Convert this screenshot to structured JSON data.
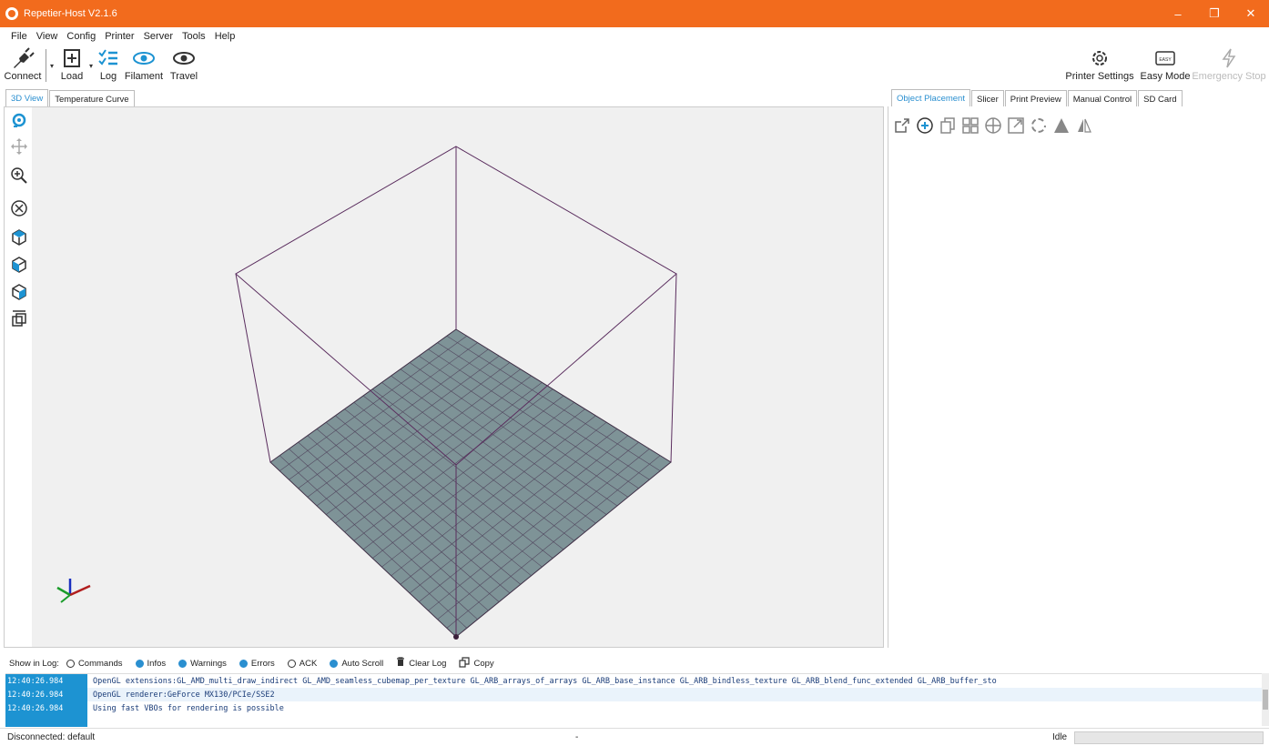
{
  "window": {
    "title": "Repetier-Host V2.1.6"
  },
  "menu": [
    "File",
    "View",
    "Config",
    "Printer",
    "Server",
    "Tools",
    "Help"
  ],
  "toolbar": {
    "connect": "Connect",
    "load": "Load",
    "log": "Log",
    "filament": "Filament",
    "travel": "Travel",
    "printer_settings": "Printer Settings",
    "easy_mode": "Easy Mode",
    "easy_badge": "EASY",
    "emergency_stop": "Emergency Stop"
  },
  "left_tabs": [
    "3D View",
    "Temperature Curve"
  ],
  "right_tabs": [
    "Object Placement",
    "Slicer",
    "Print Preview",
    "Manual Control",
    "SD Card"
  ],
  "log": {
    "show_in_log": "Show in Log:",
    "options": [
      {
        "label": "Commands",
        "on": false
      },
      {
        "label": "Infos",
        "on": true
      },
      {
        "label": "Warnings",
        "on": true
      },
      {
        "label": "Errors",
        "on": true
      },
      {
        "label": "ACK",
        "on": false
      },
      {
        "label": "Auto Scroll",
        "on": true
      }
    ],
    "clear_log": "Clear Log",
    "copy": "Copy",
    "entries": [
      {
        "time": "12:40:26.984",
        "text": "OpenGL extensions:GL_AMD_multi_draw_indirect GL_AMD_seamless_cubemap_per_texture GL_ARB_arrays_of_arrays GL_ARB_base_instance GL_ARB_bindless_texture GL_ARB_blend_func_extended GL_ARB_buffer_sto"
      },
      {
        "time": "12:40:26.984",
        "text": "OpenGL renderer:GeForce MX130/PCIe/SSE2"
      },
      {
        "time": "12:40:26.984",
        "text": "Using fast VBOs for rendering is possible"
      }
    ]
  },
  "status": {
    "connection": "Disconnected: default",
    "center": "-",
    "state": "Idle"
  }
}
